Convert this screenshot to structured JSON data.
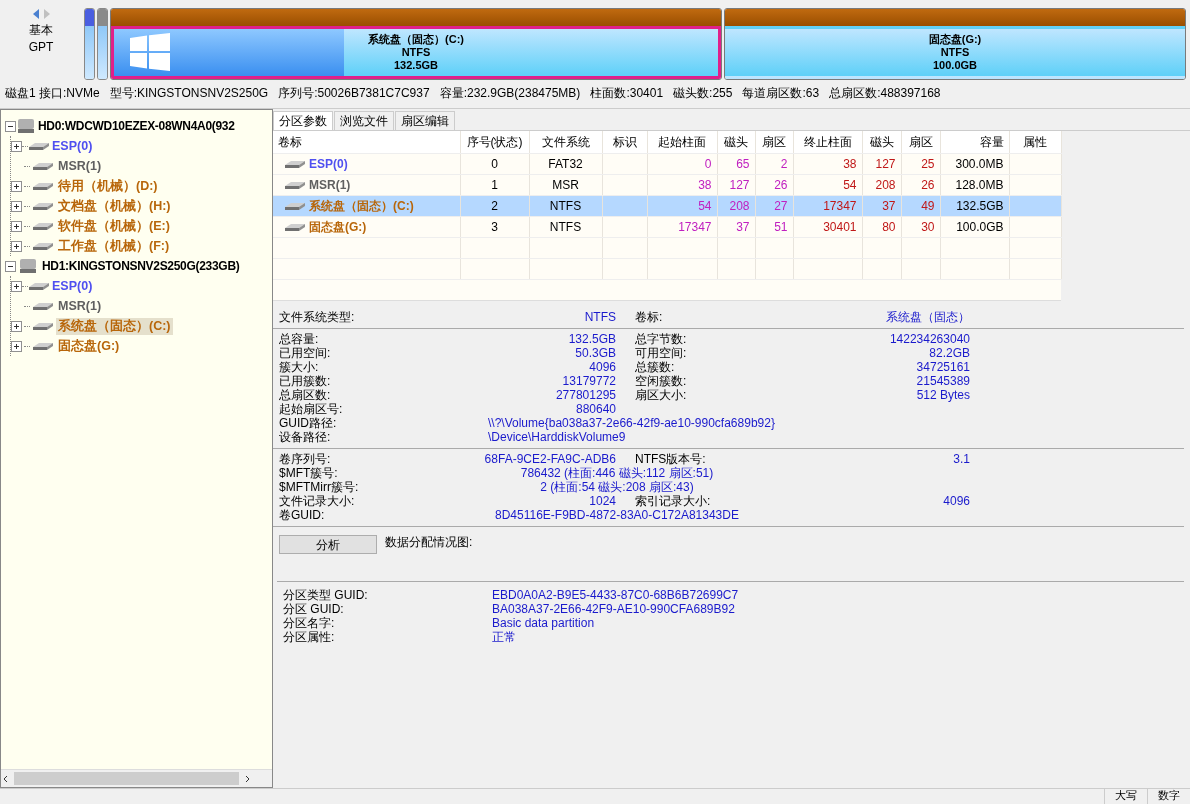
{
  "disk_map": {
    "nav": [
      "基本",
      "GPT"
    ],
    "partitions": [
      {
        "kind": "slim",
        "color": "#4a5ee0"
      },
      {
        "kind": "slim",
        "color": "#8a8a8a"
      },
      {
        "kind": "wide",
        "label": "系统盘（固态）(C:)",
        "fs": "NTFS",
        "size": "132.5GB",
        "selected": true,
        "level": 0.38
      },
      {
        "kind": "wide",
        "label": "固态盘(G:)",
        "fs": "NTFS",
        "size": "100.0GB",
        "selected": false
      }
    ]
  },
  "disk_info": [
    "磁盘1 接口:NVMe",
    "型号:KINGSTONSNV2S250G",
    "序列号:50026B7381C7C937",
    "容量:232.9GB(238475MB)",
    "柱面数:30401",
    "磁头数:255",
    "每道扇区数:63",
    "总扇区数:488397168"
  ],
  "tree": [
    {
      "label": "HD0:WDCWD10EZEX-08WN4A0(932",
      "expanded": true,
      "selected": false,
      "children": [
        {
          "label": "ESP(0)",
          "color": "#5050f0",
          "kind": "folder",
          "selected": false
        },
        {
          "label": "MSR(1)",
          "color": "#606060",
          "kind": "leaf",
          "selected": false
        },
        {
          "label": "待用（机械）(D:)",
          "color": "#b8660a",
          "kind": "folder",
          "selected": false
        },
        {
          "label": "文档盘（机械）(H:)",
          "color": "#b8660a",
          "kind": "folder",
          "selected": false
        },
        {
          "label": "软件盘（机械）(E:)",
          "color": "#b8660a",
          "kind": "folder",
          "selected": false
        },
        {
          "label": "工作盘（机械）(F:)",
          "color": "#b8660a",
          "kind": "folder",
          "selected": false
        }
      ]
    },
    {
      "label": "HD1:KINGSTONSNV2S250G(233GB)",
      "expanded": true,
      "selected": false,
      "children": [
        {
          "label": "ESP(0)",
          "color": "#5050f0",
          "kind": "folder",
          "selected": false
        },
        {
          "label": "MSR(1)",
          "color": "#606060",
          "kind": "leaf",
          "selected": false
        },
        {
          "label": "系统盘（固态）(C:)",
          "color": "#b8660a",
          "kind": "folder",
          "selected": true
        },
        {
          "label": "固态盘(G:)",
          "color": "#b8660a",
          "kind": "folder",
          "selected": false
        }
      ]
    }
  ],
  "tabs": [
    {
      "label": "分区参数",
      "selected": true
    },
    {
      "label": "浏览文件",
      "selected": false
    },
    {
      "label": "扇区编辑",
      "selected": false
    }
  ],
  "table": {
    "columns": [
      {
        "label": "卷标",
        "kind": "name"
      },
      {
        "label": "序号(状态)",
        "kind": "center"
      },
      {
        "label": "文件系统",
        "kind": "center"
      },
      {
        "label": "标识",
        "kind": "center"
      },
      {
        "label": "起始柱面",
        "kind": "start"
      },
      {
        "label": "磁头",
        "kind": "start"
      },
      {
        "label": "扇区",
        "kind": "start"
      },
      {
        "label": "终止柱面",
        "kind": "end"
      },
      {
        "label": "磁头",
        "kind": "end"
      },
      {
        "label": "扇区",
        "kind": "end"
      },
      {
        "label": "容量",
        "kind": "right"
      },
      {
        "label": "属性",
        "kind": "center"
      }
    ],
    "rows": [
      {
        "selected": false,
        "color": "#5050f0",
        "cells": [
          "ESP(0)",
          "0",
          "FAT32",
          "",
          "0",
          "65",
          "2",
          "38",
          "127",
          "25",
          "300.0MB",
          ""
        ]
      },
      {
        "selected": false,
        "color": "#606060",
        "cells": [
          "MSR(1)",
          "1",
          "MSR",
          "",
          "38",
          "127",
          "26",
          "54",
          "208",
          "26",
          "128.0MB",
          ""
        ]
      },
      {
        "selected": true,
        "color": "#b8660a",
        "cells": [
          "系统盘（固态）(C:)",
          "2",
          "NTFS",
          "",
          "54",
          "208",
          "27",
          "17347",
          "37",
          "49",
          "132.5GB",
          ""
        ]
      },
      {
        "selected": false,
        "color": "#b8660a",
        "cells": [
          "固态盘(G:)",
          "3",
          "NTFS",
          "",
          "17347",
          "37",
          "51",
          "30401",
          "80",
          "30",
          "100.0GB",
          ""
        ]
      }
    ]
  },
  "info_sections": [
    [
      {
        "kind": "pair",
        "label": "文件系统类型:",
        "value": "NTFS",
        "label2": "卷标:",
        "value2": "系统盘（固态）"
      }
    ],
    [
      {
        "kind": "pair",
        "label": "总容量:",
        "value": "132.5GB",
        "label2": "总字节数:",
        "value2": "142234263040"
      },
      {
        "kind": "pair",
        "label": "已用空间:",
        "value": "50.3GB",
        "label2": "可用空间:",
        "value2": "82.2GB"
      },
      {
        "kind": "pair",
        "label": "簇大小:",
        "value": "4096",
        "label2": "总簇数:",
        "value2": "34725161"
      },
      {
        "kind": "pair",
        "label": "已用簇数:",
        "value": "13179772",
        "label2": "空闲簇数:",
        "value2": "21545389"
      },
      {
        "kind": "pair",
        "label": "总扇区数:",
        "value": "277801295",
        "label2": "扇区大小:",
        "value2": "512 Bytes"
      },
      {
        "kind": "single",
        "label": "起始扇区号:",
        "value": "880640"
      },
      {
        "kind": "wide",
        "label": "GUID路径:",
        "value": "\\\\?\\Volume{ba038a37-2e66-42f9-ae10-990cfa689b92}"
      },
      {
        "kind": "wide",
        "label": "设备路径:",
        "value": "\\Device\\HarddiskVolume9"
      }
    ],
    [
      {
        "kind": "pair",
        "label": "卷序列号:",
        "value": "68FA-9CE2-FA9C-ADB6",
        "label2": "NTFS版本号:",
        "value2": "3.1"
      },
      {
        "kind": "center",
        "label": "$MFT簇号:",
        "value": "786432 (柱面:446 磁头:112 扇区:51)"
      },
      {
        "kind": "center",
        "label": "$MFTMirr簇号:",
        "value": "2 (柱面:54 磁头:208 扇区:43)"
      },
      {
        "kind": "pair",
        "label": "文件记录大小:",
        "value": "1024",
        "label2": "索引记录大小:",
        "value2": "4096"
      },
      {
        "kind": "center",
        "label": "卷GUID:",
        "value": "8D45116E-F9BD-4872-83A0-C172A81343DE"
      }
    ]
  ],
  "analyze": {
    "button": "分析",
    "label": "数据分配情况图:"
  },
  "gpt_info": [
    {
      "label": "分区类型 GUID:",
      "value": "EBD0A0A2-B9E5-4433-87C0-68B6B72699C7"
    },
    {
      "label": "分区 GUID:",
      "value": "BA038A37-2E66-42F9-AE10-990CFA689B92"
    },
    {
      "label": "分区名字:",
      "value": "Basic data partition"
    },
    {
      "label": "分区属性:",
      "value": "正常"
    }
  ],
  "status_bar": [
    "大写",
    "数字"
  ]
}
